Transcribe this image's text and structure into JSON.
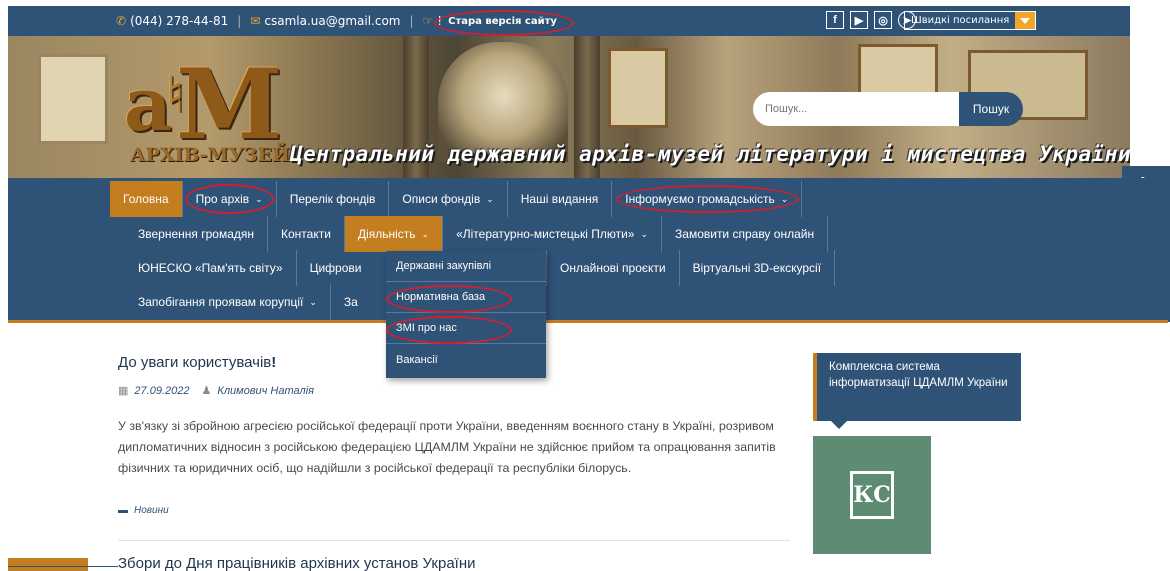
{
  "topbar": {
    "phone": "(044) 278-44-81",
    "email": "csamla.ua@gmail.com",
    "exclaim": "!",
    "old_site": "Стара версія сайту",
    "quick_links": "Швидкі посилання",
    "social_icons": [
      "facebook-icon",
      "youtube-icon",
      "instagram-icon",
      "telegram-icon"
    ]
  },
  "banner": {
    "logo_text": "АРХІВ-МУЗЕЙ",
    "title": "Центральний державний архів-музей літератури і мистецтва України",
    "search_placeholder": "Пошук...",
    "search_button": "Пошук"
  },
  "nav": {
    "row1": [
      {
        "label": "Головна",
        "has_submenu": false
      },
      {
        "label": "Про архів",
        "has_submenu": true
      },
      {
        "label": "Перелік фондів",
        "has_submenu": false
      },
      {
        "label": "Описи фондів",
        "has_submenu": true
      },
      {
        "label": "Наші видання",
        "has_submenu": false
      },
      {
        "label": "Інформуємо громадськість",
        "has_submenu": true
      }
    ],
    "row2": [
      {
        "label": "Звернення громадян",
        "has_submenu": false
      },
      {
        "label": "Контакти",
        "has_submenu": false
      },
      {
        "label": "Діяльність",
        "has_submenu": true
      },
      {
        "label": "«Літературно-мистецькі Плюти»",
        "has_submenu": true
      },
      {
        "label": "Замовити справу онлайн",
        "has_submenu": false
      }
    ],
    "row3": [
      {
        "label": "ЮНЕСКО «Пам'ять світу»",
        "has_submenu": false
      },
      {
        "label": "Цифрови",
        "has_submenu": false
      },
      {
        "label": "Онлайнові проєкти",
        "has_submenu": false
      },
      {
        "label": "Віртуальні 3D-екскурсії",
        "has_submenu": false
      }
    ],
    "row4": [
      {
        "label": "Запобігання проявам корупції",
        "has_submenu": true
      },
      {
        "label": "За",
        "has_submenu": false
      }
    ],
    "dropdown": [
      "Державні закупівлі",
      "Нормативна база",
      "ЗМІ про нас",
      "Вакансії"
    ]
  },
  "main": {
    "post1": {
      "title": "До уваги користувачів",
      "title_mark": "!",
      "date": "27.09.2022",
      "author": "Климович Наталія",
      "excerpt": "У зв'язку зі збройною агресією російської федерації проти України, введенням воєнного стану в Україні, розривом дипломатичних відносин з російською федерацією ЦДАМЛМ України не здійснює прийом та опрацювання запитів фізичних та юридичних осіб, що надійшли з російської федерації та республіки білорусь.",
      "category": "Новини"
    },
    "post2": {
      "title": "Збори до Дня працівників архівних установ України"
    }
  },
  "sidebar": {
    "box_title": "Комплексна система інформатизації ЦДАМЛМ України",
    "logo_text": "КС"
  },
  "colors": {
    "primary": "#2f5277",
    "accent": "#c37e1f",
    "highlight": "#d1202f"
  }
}
